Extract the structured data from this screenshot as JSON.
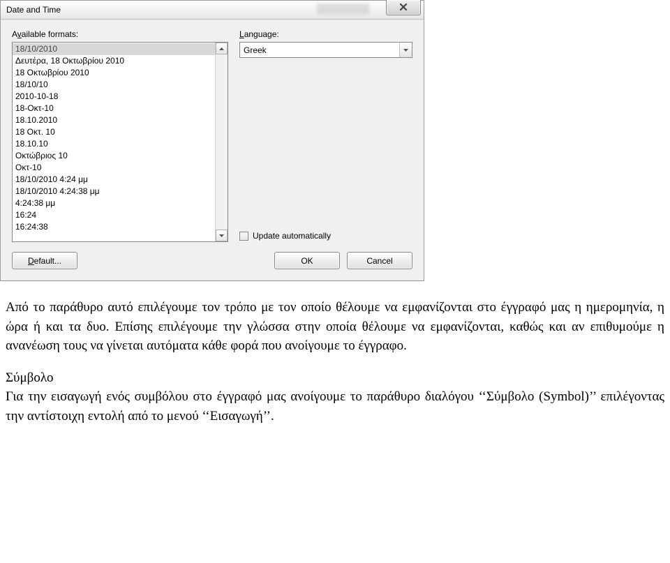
{
  "dialog": {
    "title": "Date and Time",
    "formats_label_pre": "A",
    "formats_label_ul": "v",
    "formats_label_post": "ailable formats:",
    "language_label_ul": "L",
    "language_label_post": "anguage:",
    "language_value": "Greek",
    "update_label_ul": "U",
    "update_label_post": "pdate automatically",
    "formats": [
      "18/10/2010",
      "Δευτέρα, 18 Οκτωβρίου 2010",
      "18 Οκτωβρίου 2010",
      "18/10/10",
      "2010-10-18",
      "18-Οκτ-10",
      "18.10.2010",
      "18 Οκτ. 10",
      "18.10.10",
      "Οκτώβριος 10",
      "Οκτ-10",
      "18/10/2010 4:24 μμ",
      "18/10/2010 4:24:38 μμ",
      "4:24:38 μμ",
      "16:24",
      "16:24:38"
    ],
    "selected_index": 0,
    "buttons": {
      "default_ul": "D",
      "default_post": "efault...",
      "ok": "OK",
      "cancel": "Cancel"
    }
  },
  "doc": {
    "p1": "Από το παράθυρο αυτό επιλέγουμε τον τρόπο με τον οποίο θέλουμε να εμφανίζονται στο έγγραφό μας η ημερομηνία, η ώρα ή και τα δυο. Επίσης επιλέγουμε την γλώσσα στην οποία θέλουμε να εμφανίζονται, καθώς και αν επιθυμούμε η ανανέωση τους να γίνεται αυτόματα κάθε φορά που ανοίγουμε το έγγραφο.",
    "heading": "Σύμβολο",
    "p2": "Για την εισαγωγή ενός συμβόλου στο έγγραφό μας ανοίγουμε το παράθυρο διαλόγου ‘‘Σύμβολο (Symbol)’’ επιλέγοντας την αντίστοιχη εντολή από το μενού ‘‘Εισαγωγή’’."
  }
}
